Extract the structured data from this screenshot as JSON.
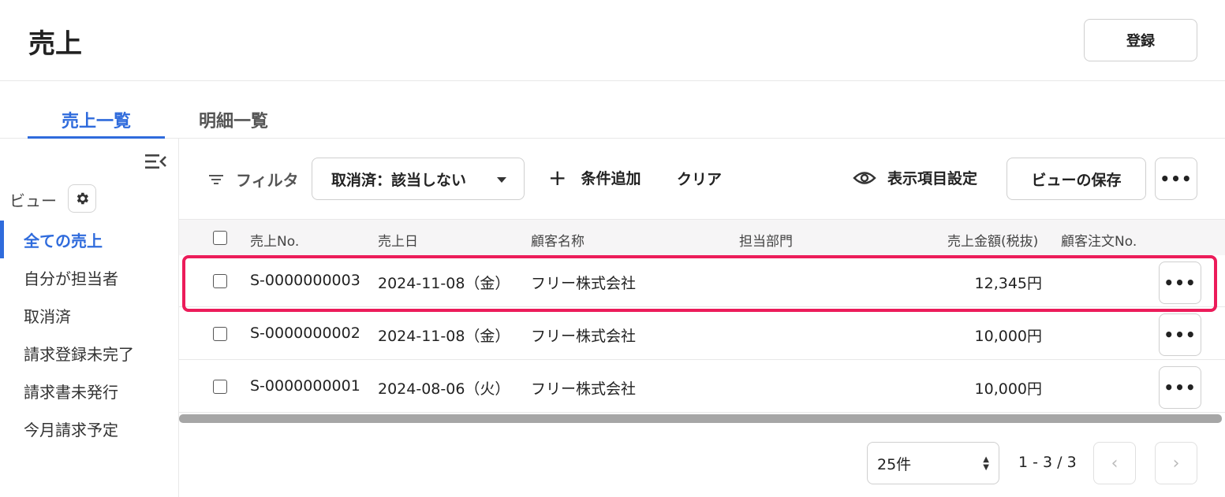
{
  "header": {
    "title": "売上",
    "register_label": "登録"
  },
  "tabs": [
    {
      "label": "売上一覧",
      "active": true
    },
    {
      "label": "明細一覧",
      "active": false
    }
  ],
  "sidebar": {
    "collapse_icon": "collapse-menu-icon",
    "view_label": "ビュー",
    "view_settings_icon": "gear-icon",
    "items": [
      {
        "label": "全ての売上",
        "active": true
      },
      {
        "label": "自分が担当者",
        "active": false
      },
      {
        "label": "取消済",
        "active": false
      },
      {
        "label": "請求登録未完了",
        "active": false
      },
      {
        "label": "請求書未発行",
        "active": false
      },
      {
        "label": "今月請求予定",
        "active": false
      }
    ]
  },
  "toolbar": {
    "filter_label": "フィルタ",
    "filter_chip": "取消済：該当しない",
    "add_condition": "条件追加",
    "clear": "クリア",
    "display_settings": "表示項目設定",
    "save_view": "ビューの保存",
    "more": "•••"
  },
  "table": {
    "columns": [
      "売上No.",
      "売上日",
      "顧客名称",
      "担当部門",
      "売上金額(税抜)",
      "顧客注文No."
    ],
    "rows": [
      {
        "no": "S-0000000003",
        "date": "2024-11-08（金）",
        "customer": "フリー株式会社",
        "dept": "",
        "amount": "12,345円",
        "order_no": "",
        "highlighted": true
      },
      {
        "no": "S-0000000002",
        "date": "2024-11-08（金）",
        "customer": "フリー株式会社",
        "dept": "",
        "amount": "10,000円",
        "order_no": "",
        "highlighted": false
      },
      {
        "no": "S-0000000001",
        "date": "2024-08-06（火）",
        "customer": "フリー株式会社",
        "dept": "",
        "amount": "10,000円",
        "order_no": "",
        "highlighted": false
      }
    ],
    "row_more": "•••"
  },
  "pagination": {
    "page_size": "25件",
    "range": "1 - 3 / 3"
  },
  "colors": {
    "accent": "#2f6bdc",
    "highlight": "#ec1c5a"
  }
}
